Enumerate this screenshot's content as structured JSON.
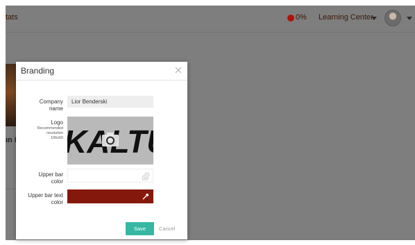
{
  "header": {
    "title_partial": "tats",
    "progress_text": "0%",
    "progress_color": "#b11208",
    "learning_center_label": "Learning Center",
    "icons": [
      "caret-down-icon",
      "avatar",
      "caret-down-icon"
    ]
  },
  "background": {
    "card_text_partial": "ın I"
  },
  "modal": {
    "title": "Branding",
    "close_icon": "close-icon",
    "company_name_label_line1": "Company",
    "company_name_label_line2": "name",
    "company_name_value": "Lior Benderski",
    "logo_label": "Logo",
    "logo_hint_line1": "Recommended",
    "logo_hint_line2": "resolution",
    "logo_hint_line3": "106x60",
    "logo_image_text": "KALTU",
    "logo_overlay_icon": "camera-icon",
    "upper_bar_color_label_line1": "Upper bar",
    "upper_bar_color_label_line2": "color",
    "upper_bar_color_value": "#ffffff",
    "upper_bar_color_icon": "paperclip-icon",
    "upper_bar_text_color_label_line1": "Upper bar text",
    "upper_bar_text_color_label_line2": "color",
    "upper_bar_text_color_value": "#85180c",
    "upper_bar_text_color_icon": "eyedropper-icon",
    "save_label": "Save",
    "save_color": "#36b7a3",
    "cancel_label": "Cancel"
  }
}
